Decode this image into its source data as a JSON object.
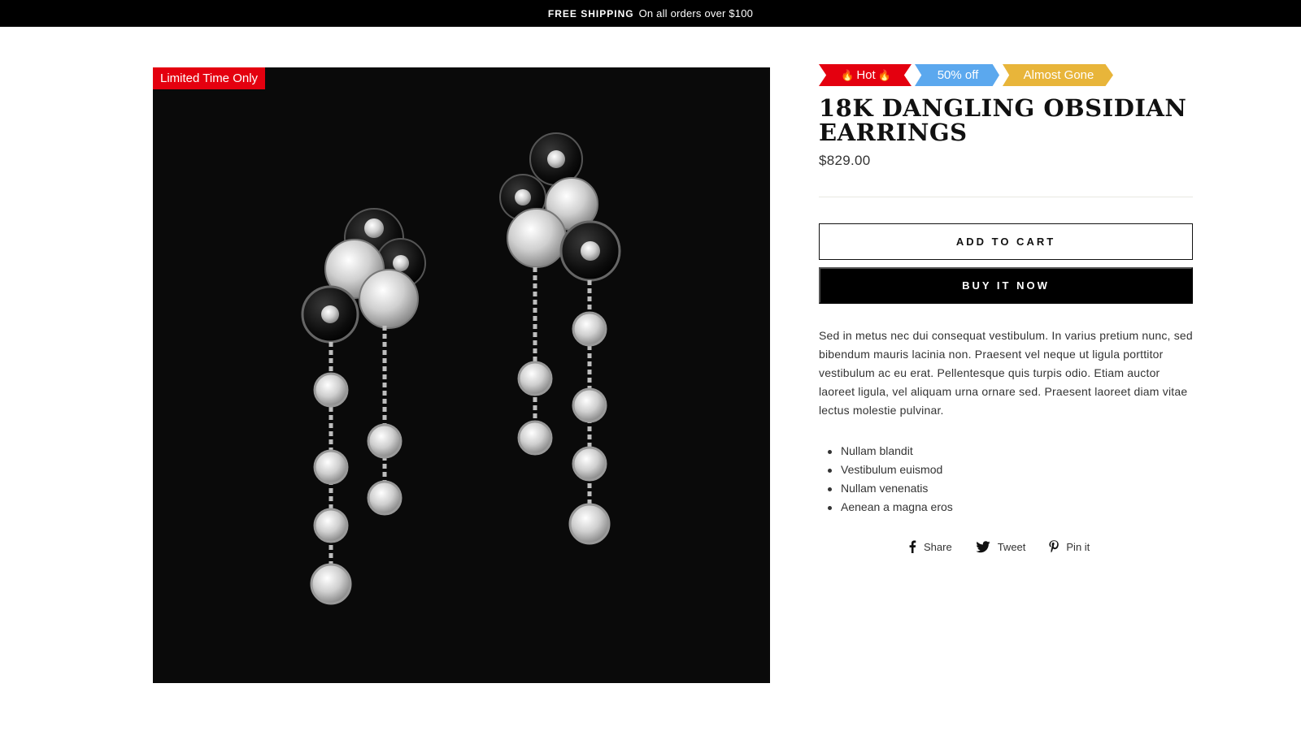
{
  "announcement": {
    "bold": "FREE SHIPPING",
    "text": "On all orders over $100"
  },
  "product": {
    "image_badge": "Limited Time Only",
    "badges": [
      {
        "label": "Hot",
        "color": "#e4000f",
        "icon": "fire-icon"
      },
      {
        "label": "50% off",
        "color": "#5ba8ee"
      },
      {
        "label": "Almost Gone",
        "color": "#e8b53a"
      }
    ],
    "title": "18K Dangling Obsidian Earrings",
    "price": "$829.00",
    "add_to_cart": "Add to cart",
    "buy_now": "Buy it now",
    "description": "Sed in metus nec dui consequat vestibulum. In varius pretium nunc, sed bibendum mauris lacinia non. Praesent vel neque ut ligula porttitor vestibulum ac eu erat. Pellentesque quis turpis odio. Etiam auctor laoreet ligula, vel aliquam urna ornare sed. Praesent laoreet diam vitae lectus molestie pulvinar.",
    "features": [
      "Nullam blandit",
      "Vestibulum euismod",
      "Nullam venenatis",
      "Aenean a magna eros"
    ]
  },
  "social": [
    {
      "label": "Share",
      "icon": "facebook-icon"
    },
    {
      "label": "Tweet",
      "icon": "twitter-icon"
    },
    {
      "label": "Pin it",
      "icon": "pinterest-icon"
    }
  ],
  "colors": {
    "accent_red": "#e4000f",
    "background_dark": "#0a0a0a",
    "button_black": "#000000"
  }
}
